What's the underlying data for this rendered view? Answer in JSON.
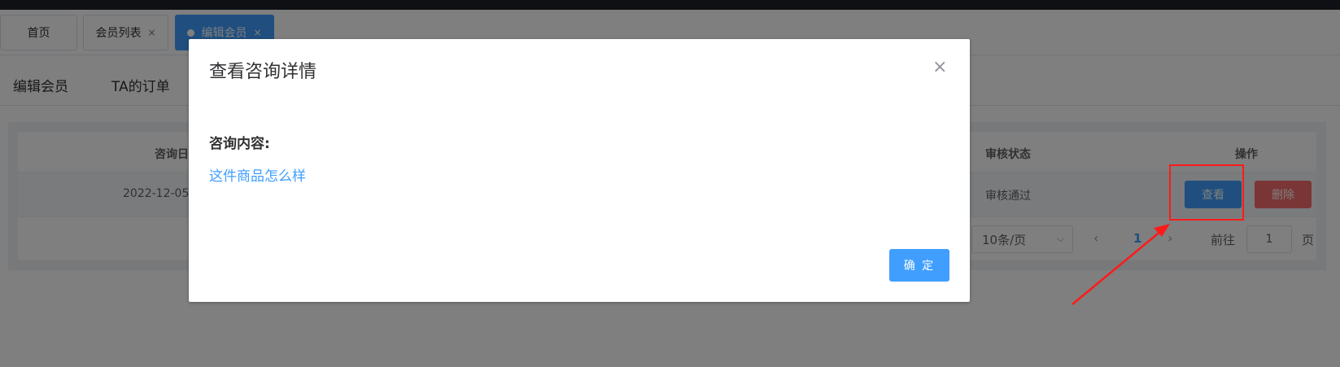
{
  "tabs": [
    {
      "label": "首页",
      "closable": false
    },
    {
      "label": "会员列表",
      "closable": true
    },
    {
      "label": "编辑会员",
      "closable": true,
      "active": true
    }
  ],
  "close_glyph": "×",
  "subtabs": [
    "编辑会员",
    "TA的订单"
  ],
  "table": {
    "headers": {
      "date": "咨询日",
      "status": "审核状态",
      "action": "操作"
    },
    "rows": [
      {
        "date": "2022-12-05",
        "status": "审核通过",
        "view": "查看",
        "delete": "删除"
      }
    ]
  },
  "pagination": {
    "page_size": "10条/页",
    "current": "1",
    "goto_label": "前往",
    "goto_value": "1",
    "goto_suffix": "页"
  },
  "dialog": {
    "title": "查看咨询详情",
    "close": "×",
    "label": "咨询内容:",
    "content": "这件商品怎么样",
    "ok": "确 定"
  },
  "colors": {
    "primary": "#409eff",
    "danger": "#f56c6c",
    "annotation": "#ff1a1a"
  }
}
